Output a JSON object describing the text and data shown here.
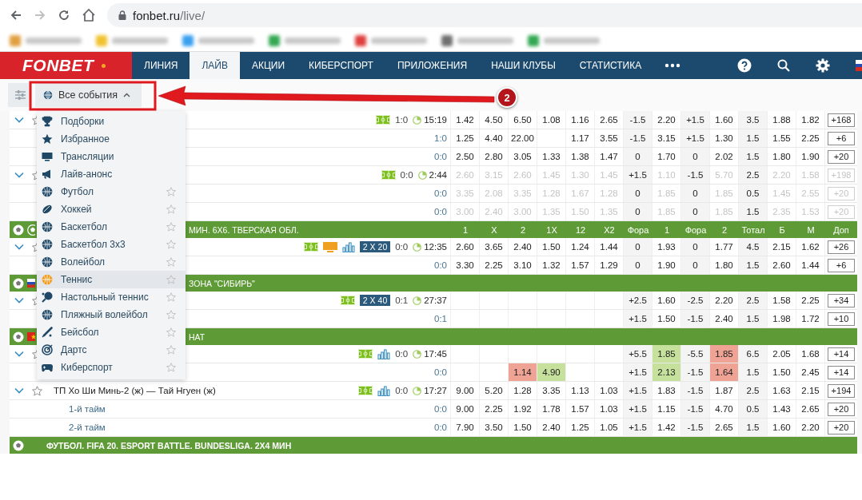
{
  "browser": {
    "url_host": "fonbet.ru",
    "url_path": "/live/",
    "back_disabled": false,
    "forward_disabled": true
  },
  "bookmarks": [
    {
      "color": "#e0a040"
    },
    {
      "color": "#f2c230"
    },
    {
      "color": "#3aa0f0"
    },
    {
      "color": "#34a853"
    },
    {
      "color": "#e04040"
    },
    {
      "color": "#707070"
    },
    {
      "color": "#34a853"
    }
  ],
  "nav": {
    "logo": "FONBET",
    "items": [
      {
        "label": "ЛИНИЯ",
        "selected": false
      },
      {
        "label": "ЛАЙВ",
        "selected": true
      },
      {
        "label": "АКЦИИ",
        "selected": false
      },
      {
        "label": "КИБЕРСПОРТ",
        "selected": false
      },
      {
        "label": "ПРИЛОЖЕНИЯ",
        "selected": false
      },
      {
        "label": "НАШИ КЛУБЫ",
        "selected": false
      },
      {
        "label": "СТАТИСТИКА",
        "selected": false
      }
    ]
  },
  "filter": {
    "label": "Все события",
    "open": true
  },
  "annotation": {
    "label": "2"
  },
  "menu": [
    {
      "label": "Подборки",
      "star": false,
      "selected": false
    },
    {
      "label": "Избранное",
      "star": false,
      "selected": false
    },
    {
      "label": "Трансляции",
      "star": false,
      "selected": false
    },
    {
      "label": "Лайв-анонс",
      "star": false,
      "selected": false
    },
    {
      "label": "Футбол",
      "star": true,
      "selected": false
    },
    {
      "label": "Хоккей",
      "star": true,
      "selected": false
    },
    {
      "label": "Баскетбол",
      "star": true,
      "selected": false
    },
    {
      "label": "Баскетбол 3x3",
      "star": true,
      "selected": false
    },
    {
      "label": "Волейбол",
      "star": true,
      "selected": false
    },
    {
      "label": "Теннис",
      "star": true,
      "selected": true
    },
    {
      "label": "Настольный теннис",
      "star": true,
      "selected": false
    },
    {
      "label": "Пляжный волейбол",
      "star": true,
      "selected": false
    },
    {
      "label": "Бейсбол",
      "star": true,
      "selected": false
    },
    {
      "label": "Дартс",
      "star": true,
      "selected": false
    },
    {
      "label": "Киберспорт",
      "star": true,
      "selected": false
    }
  ],
  "rows": [
    {
      "kind": "event",
      "starred": false,
      "field": true,
      "score": "1:0",
      "time": "15:19",
      "suspended": false,
      "values": {
        "col_1": "1.42",
        "col_2": "4.50",
        "col_3": "6.50",
        "col_4": "1.08",
        "col_5": "1.16",
        "col_6": "2.65",
        "col_7": "-1.5",
        "col_8": "2.20",
        "col_9": "+1.5",
        "col_10": "1.60",
        "col_11": "3.5",
        "col_12": "1.88",
        "col_13": "1.82"
      },
      "more": "+168"
    },
    {
      "kind": "sub",
      "score": "1:0",
      "suspended": false,
      "values": {
        "col_1": "1.25",
        "col_2": "4.40",
        "col_3": "22.00",
        "col_5": "1.17",
        "col_6": "3.55",
        "col_7": "-1.5",
        "col_8": "3.15",
        "col_9": "+1.5",
        "col_10": "1.30",
        "col_11": "1.5",
        "col_12": "1.55",
        "col_13": "2.25"
      },
      "more": "+6"
    },
    {
      "kind": "sub",
      "score": "0:0",
      "suspended": false,
      "values": {
        "col_1": "2.50",
        "col_2": "2.80",
        "col_3": "3.05",
        "col_4": "1.33",
        "col_5": "1.38",
        "col_6": "1.47",
        "col_7": "0",
        "col_8": "1.70",
        "col_9": "0",
        "col_10": "2.02",
        "col_11": "1.5",
        "col_12": "1.80",
        "col_13": "1.90"
      },
      "more": "+20"
    },
    {
      "kind": "event",
      "starred": false,
      "field": true,
      "score": "0:0",
      "time": "2:44",
      "suspended": true,
      "values": {
        "col_1": "2.60",
        "col_2": "3.15",
        "col_3": "2.60",
        "col_4": "1.45",
        "col_5": "1.30",
        "col_6": "1.45",
        "col_7": "+1.5",
        "col_8": "1.10",
        "col_9": "-1.5",
        "col_10": "5.70",
        "col_11": "2.5",
        "col_12": "2.20",
        "col_13": "1.58"
      },
      "more": "+198"
    },
    {
      "kind": "sub",
      "score": "0:0",
      "suspended": true,
      "values": {
        "col_1": "3.35",
        "col_2": "2.08",
        "col_3": "3.35",
        "col_4": "1.28",
        "col_5": "1.67",
        "col_6": "1.28",
        "col_7": "0",
        "col_8": "1.85",
        "col_9": "0",
        "col_10": "1.85",
        "col_11": "0.5",
        "col_12": "1.45",
        "col_13": "2.55"
      },
      "more": "+20"
    },
    {
      "kind": "sub",
      "score": "0:0",
      "suspended": true,
      "values": {
        "col_1": "3.00",
        "col_2": "2.40",
        "col_3": "3.00",
        "col_4": "1.35",
        "col_5": "1.50",
        "col_6": "1.35",
        "col_7": "0",
        "col_8": "1.85",
        "col_9": "0",
        "col_10": "1.85",
        "col_11": "1.5",
        "col_12": "2.35",
        "col_13": "1.53"
      },
      "more": "+20"
    },
    {
      "kind": "league",
      "title": "МИН. 6Х6. ТВЕРСКАЯ ОБЛ.",
      "emblem": {
        "kind": "ball"
      },
      "columns": [
        "1",
        "X",
        "2",
        "1X",
        "12",
        "X2",
        "Фора",
        "1",
        "Фора",
        "2",
        "Тотал",
        "Б",
        "М",
        "Доп"
      ]
    },
    {
      "kind": "event",
      "starred": false,
      "field": true,
      "tv": true,
      "stats": true,
      "period": "2 X 20",
      "score": "0:0",
      "time": "12:35",
      "suspended": false,
      "values": {
        "col_1": "2.60",
        "col_2": "3.65",
        "col_3": "2.40",
        "col_4": "1.50",
        "col_5": "1.24",
        "col_6": "1.44",
        "col_7": "0",
        "col_8": "1.93",
        "col_9": "0",
        "col_10": "1.77",
        "col_11": "4.5",
        "col_12": "2.15",
        "col_13": "1.62"
      },
      "more": "+26"
    },
    {
      "kind": "sub",
      "score": "0:0",
      "suspended": false,
      "values": {
        "col_1": "3.30",
        "col_2": "2.25",
        "col_3": "3.10",
        "col_4": "1.32",
        "col_5": "1.57",
        "col_6": "1.29",
        "col_7": "0",
        "col_8": "1.90",
        "col_9": "0",
        "col_10": "1.80",
        "col_11": "1.5",
        "col_12": "2.60",
        "col_13": "1.44"
      },
      "more": "+6"
    },
    {
      "kind": "league",
      "title": "ЗОНА \"СИБИРЬ\"",
      "emblem": {
        "kind": "russia"
      }
    },
    {
      "kind": "event",
      "starred": false,
      "field": true,
      "period": "2 X 40",
      "score": "0:1",
      "time": "27:37",
      "suspended": false,
      "values": {
        "col_7": "+2.5",
        "col_8": "1.60",
        "col_9": "-2.5",
        "col_10": "2.20",
        "col_11": "2.5",
        "col_12": "1.58",
        "col_13": "2.25"
      },
      "more": "+34"
    },
    {
      "kind": "sub",
      "score": "0:1",
      "suspended": false,
      "values": {
        "col_7": "+1.5",
        "col_8": "1.50",
        "col_9": "-1.5",
        "col_10": "2.40",
        "col_11": "1.5",
        "col_12": "1.98",
        "col_13": "1.72"
      },
      "more": "+10"
    },
    {
      "kind": "league",
      "title": "НАТ",
      "emblem": {
        "kind": "vietnam"
      }
    },
    {
      "kind": "event",
      "starred": false,
      "field": true,
      "stats": true,
      "score": "0:0",
      "time": "17:45",
      "suspended": false,
      "values": {
        "col_7": "+5.5",
        "col_8": {
          "text": "1.85",
          "color": "#c5e19c"
        },
        "col_9": "-5.5",
        "col_10": {
          "text": "1.85",
          "color": "#eea394"
        },
        "col_11": "6.5",
        "col_12": "2.05",
        "col_13": "1.68"
      },
      "more": "+14"
    },
    {
      "kind": "sub",
      "score": "0:0",
      "suspended": false,
      "values": {
        "col_3": {
          "text": "1.14",
          "color": "#eea394"
        },
        "col_4": {
          "text": "4.90",
          "color": "#c5e19c"
        },
        "col_7": "+1.5",
        "col_8": {
          "text": "2.13",
          "color": "#c5e19c"
        },
        "col_9": "-1.5",
        "col_10": {
          "text": "1.64",
          "color": "#eea394"
        },
        "col_11": "1.5",
        "col_12": "1.50",
        "col_13": "2.45"
      },
      "more": "+14"
    },
    {
      "kind": "event",
      "name": "ТП Хо Ши Минь-2 (ж) — Тай Нгуен (ж)",
      "starred": false,
      "field": true,
      "stats": true,
      "score": "0:0",
      "time": "17:27",
      "suspended": false,
      "values": {
        "col_1": "9.00",
        "col_2": "5.20",
        "col_3": "1.28",
        "col_4": "3.35",
        "col_5": "1.13",
        "col_6": "1.03",
        "col_7": "+1.5",
        "col_8": "1.83",
        "col_9": "-1.5",
        "col_10": "1.87",
        "col_11": "2.5",
        "col_12": "1.63",
        "col_13": "2.15"
      },
      "more": "+194"
    },
    {
      "kind": "sub",
      "name": "1-й тайм",
      "score": "0:0",
      "suspended": false,
      "values": {
        "col_1": "9.00",
        "col_2": "2.25",
        "col_3": "1.92",
        "col_4": "1.78",
        "col_5": "1.57",
        "col_6": "1.03",
        "col_7": "+1.5",
        "col_8": "1.15",
        "col_9": "-1.5",
        "col_10": "4.70",
        "col_11": "0.5",
        "col_12": "1.43",
        "col_13": "2.65"
      },
      "more": "+20"
    },
    {
      "kind": "sub",
      "name": "2-й тайм",
      "score": "0:0",
      "suspended": false,
      "values": {
        "col_1": "7.90",
        "col_2": "3.50",
        "col_3": "1.50",
        "col_4": "2.40",
        "col_5": "1.25",
        "col_6": "1.05",
        "col_7": "+1.5",
        "col_8": "1.42",
        "col_9": "-1.5",
        "col_10": "2.65",
        "col_11": "1.5",
        "col_12": "1.60",
        "col_13": "2.20"
      },
      "more": "+20"
    },
    {
      "kind": "league",
      "title": "ФУТБОЛ. FIFA 20. ESPORT BATTLE. BUNDESLIGA. 2Х4 МИН"
    }
  ]
}
